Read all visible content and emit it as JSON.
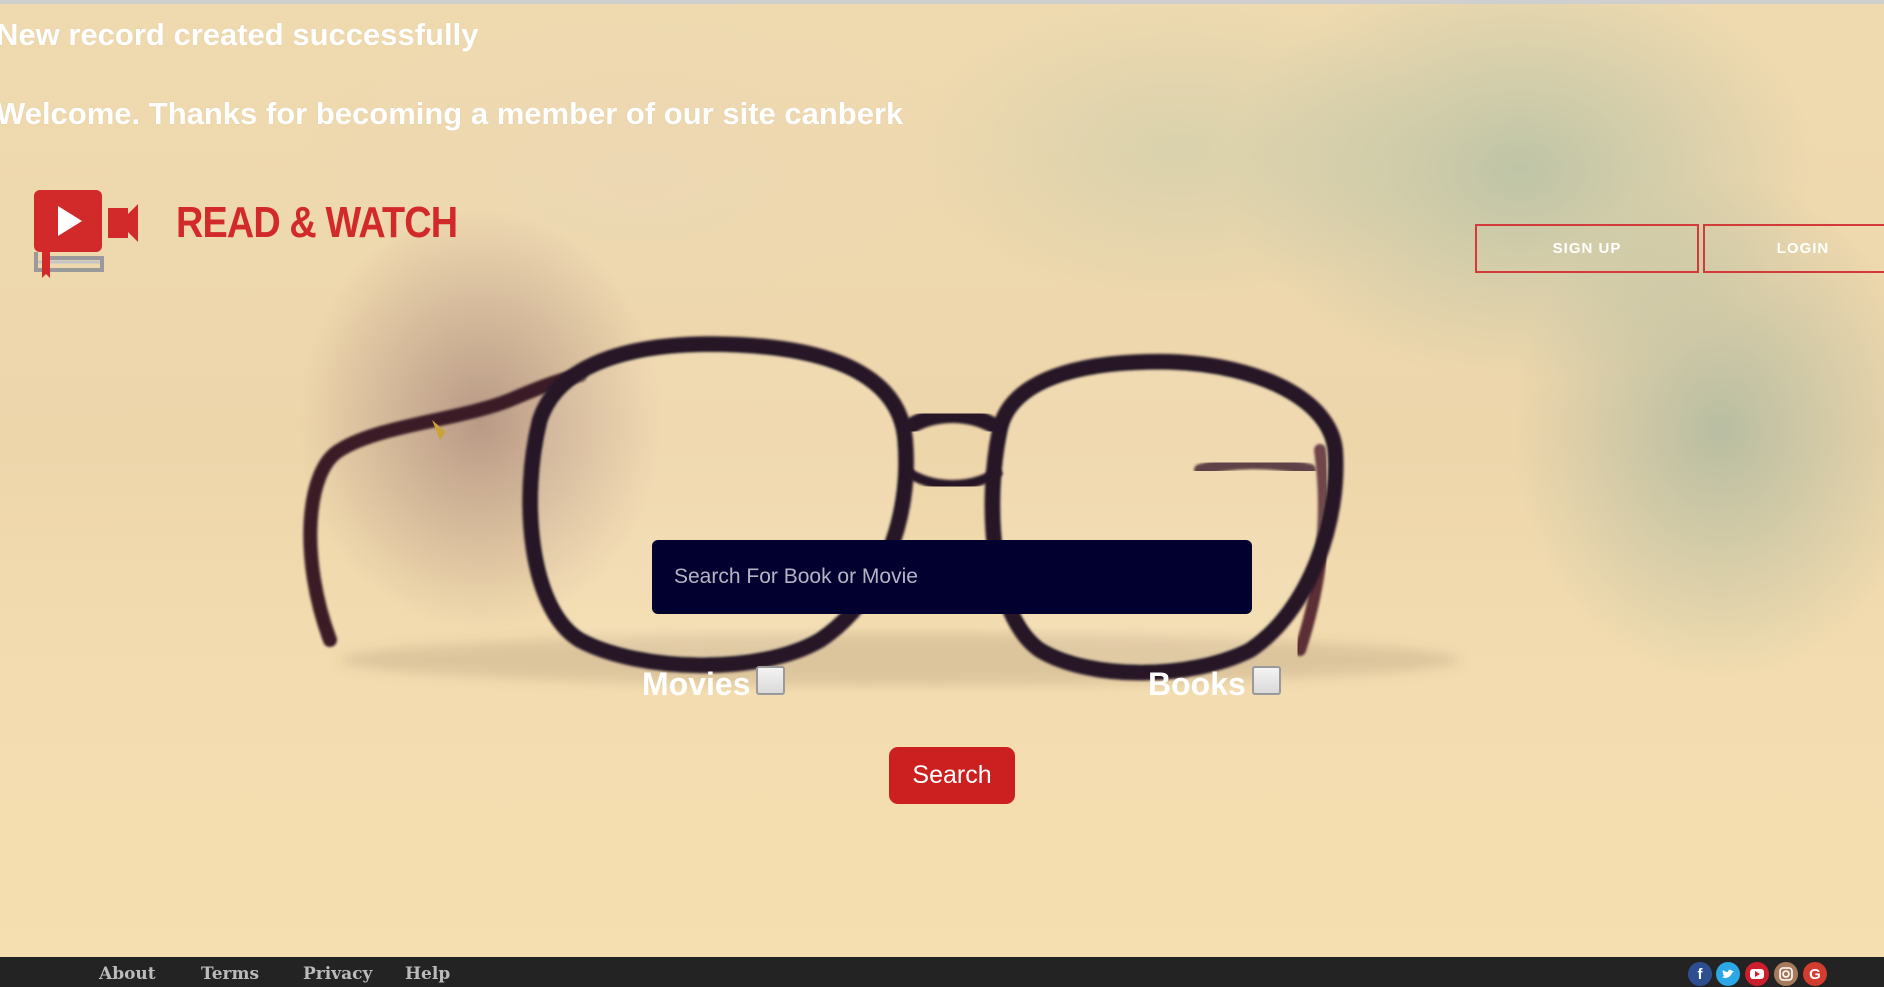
{
  "messages": {
    "record_created": "New record created successfully",
    "welcome": "Welcome. Thanks for becoming a member of our site canberk"
  },
  "brand": {
    "name": "READ & WATCH",
    "color": "#d22a2a"
  },
  "header": {
    "signup_label": "SIGN UP",
    "login_label": "LOGIN"
  },
  "search": {
    "placeholder": "Search For Book or Movie",
    "value": "",
    "movies_label": "Movies",
    "books_label": "Books",
    "movies_checked": false,
    "books_checked": false,
    "button_label": "Search",
    "button_color": "#cc1f1f",
    "box_color": "#02002f"
  },
  "footer": {
    "links": [
      "About",
      "Terms",
      "Privacy",
      "Help"
    ],
    "social_icons": [
      "facebook-icon",
      "twitter-icon",
      "youtube-icon",
      "instagram-icon",
      "google-plus-icon"
    ]
  }
}
